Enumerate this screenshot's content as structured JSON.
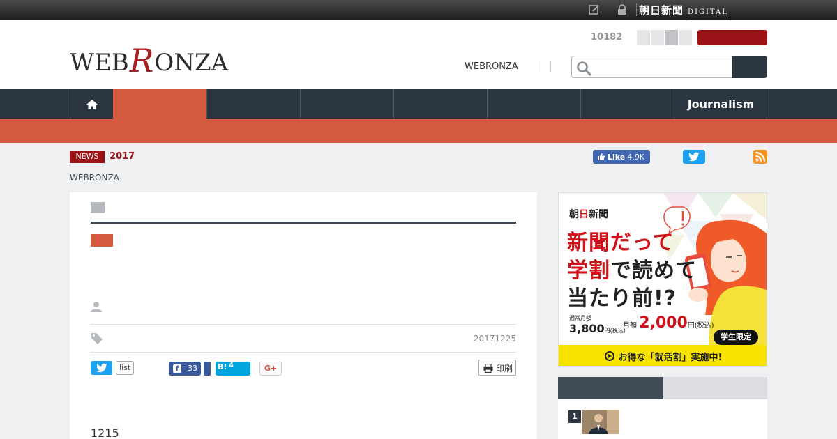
{
  "topbar": {
    "brand_jp": "朝日新聞",
    "brand_en": "DIGITAL",
    "icons": [
      "edit-icon",
      "lock-icon"
    ]
  },
  "header": {
    "logo_pre": "WEB",
    "logo_r": "R",
    "logo_post": "ONZA",
    "count": "10182",
    "nav_link": "WEBRONZA",
    "search_placeholder": ""
  },
  "nav": {
    "journalism": "Journalism",
    "icons": [
      "home-icon"
    ]
  },
  "meta": {
    "news_badge": "NEWS",
    "year": "2017",
    "breadcrumb": "WEBRONZA",
    "fb_like": "Like",
    "fb_like_count": "4.9K"
  },
  "article": {
    "date": "20171225",
    "list_label": "list",
    "fb_count": "33",
    "hatena_label": "B!",
    "hatena_count": "4",
    "gplus_label": "G+",
    "print_label": "印刷",
    "body_first": "1215"
  },
  "ad": {
    "brand_a": "朝",
    "brand_sun": "日",
    "brand_b": "新聞",
    "line1_red": "新聞だって",
    "line2_red": "学割",
    "line2_rest": "で読めて",
    "line3": "当たり前!?",
    "price_label": "通常月額",
    "price_regular": "3,800",
    "price_unit": "円(税込)",
    "price_label2": "月額",
    "price_student": "2,000",
    "badge": "学生限定",
    "cta": "お得な「就活割」実施中!"
  },
  "ranking": {
    "first_num": "1"
  },
  "colors": {
    "nav_bg": "#2c3640",
    "accent": "#d35a3e",
    "brand_red": "#9b1316",
    "ad_yellow": "#f7e200"
  }
}
